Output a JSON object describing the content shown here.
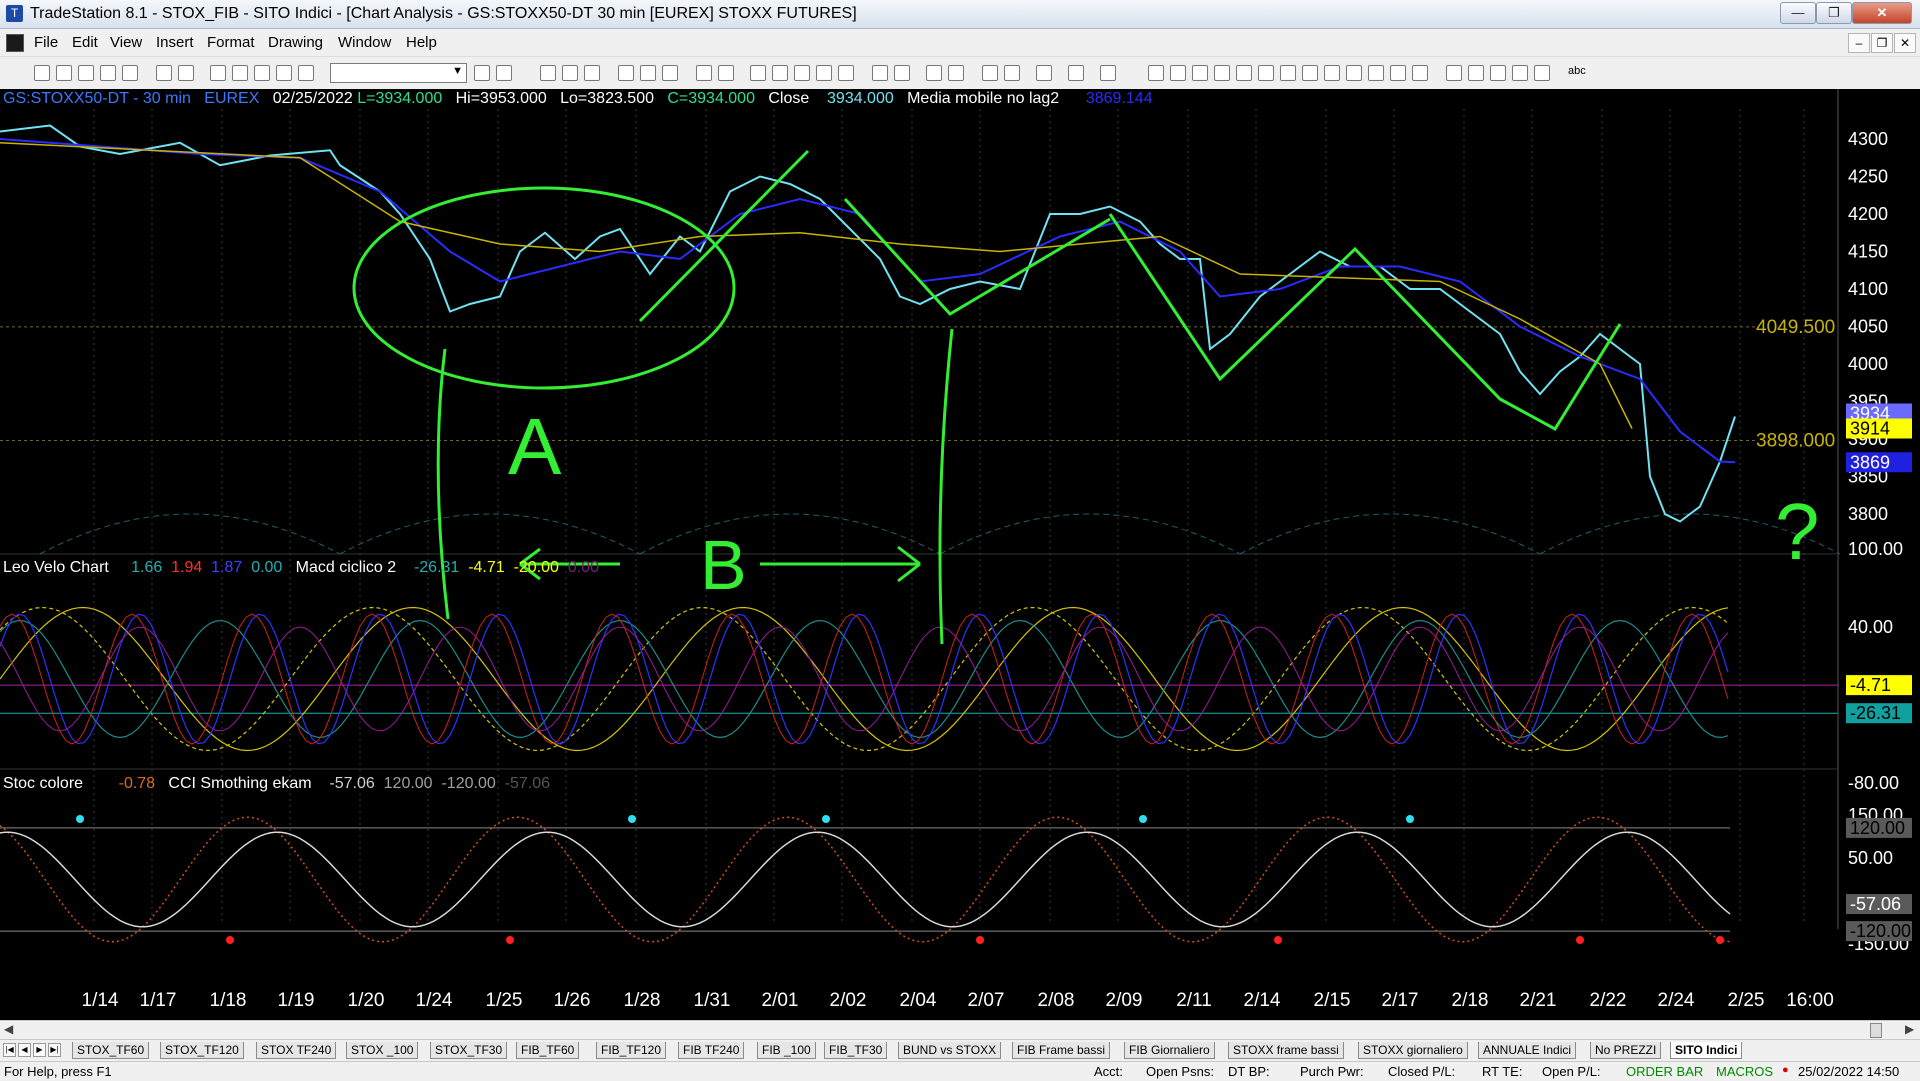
{
  "window": {
    "title": "TradeStation 8.1 - STOX_FIB - SITO Indici - [Chart Analysis - GS:STOXX50-DT  30 min  [EUREX] STOXX FUTURES]",
    "minimize": "—",
    "maximize": "❐",
    "close": "✕"
  },
  "menu": [
    "File",
    "Edit",
    "View",
    "Insert",
    "Format",
    "Drawing",
    "Window",
    "Help"
  ],
  "mdi": {
    "minimize": "–",
    "restore": "❐",
    "close": "✕"
  },
  "toolbar": {
    "abc_label": "abc"
  },
  "chart": {
    "header": {
      "symbol": "GS:STOXX50-DT - 30 min",
      "exchange": "EUREX",
      "date": "02/25/2022",
      "last": "L=3934.000",
      "high": "Hi=3953.000",
      "low": "Lo=3823.500",
      "close": "C=3934.000",
      "close_label": "Close",
      "close_value": "3934.000",
      "ma_label": "Media mobile no lag2",
      "ma_value": "3869.144"
    },
    "price_axis": [
      "4300",
      "4250",
      "4200",
      "4150",
      "4100",
      "4050",
      "4000",
      "3950",
      "3900",
      "3850",
      "3800"
    ],
    "price_marks": {
      "level_high": "4049.500",
      "level_low": "3898.000",
      "tag_close": "3934",
      "tag_yellow": "3914",
      "tag_ma": "3869"
    },
    "panel2": {
      "name": "Leo Velo Chart",
      "v1": "1.66",
      "v2": "1.94",
      "v3": "1.87",
      "v4": "0.00",
      "name2": "Macd ciclico 2",
      "m1": "-26.31",
      "m2": "-4.71",
      "m3": "-20.00",
      "m4": "0.00",
      "axis": [
        "100.00",
        "40.00",
        "-80.00"
      ],
      "tag_a": "-4.71",
      "tag_b": "-26.31"
    },
    "panel3": {
      "name": "Stoc colore",
      "v1": "-0.78",
      "name2": "CCI Smothing ekam",
      "c1": "-57.06",
      "c2": "120.00",
      "c3": "-120.00",
      "c4": "-57.06",
      "axis": [
        "150.00",
        "50.00",
        "-150.00"
      ],
      "tag_a": "120.00",
      "tag_b": "-57.06",
      "tag_c": "-120.00"
    },
    "date_axis": [
      "1/14",
      "1/17",
      "1/18",
      "1/19",
      "1/20",
      "1/24",
      "1/25",
      "1/26",
      "1/28",
      "1/31",
      "2/01",
      "2/02",
      "2/04",
      "2/07",
      "2/08",
      "2/09",
      "2/11",
      "2/14",
      "2/15",
      "2/17",
      "2/18",
      "2/21",
      "2/22",
      "2/24",
      "2/25",
      "16:00"
    ]
  },
  "tabs": [
    "STOX_TF60",
    "STOX_TF120",
    "STOX TF240",
    "STOX _100",
    "STOX_TF30",
    "FIB_TF60",
    "FIB_TF120",
    "FIB TF240",
    "FIB _100",
    "FIB_TF30",
    "BUND vs STOXX",
    "FIB Frame bassi",
    "FIB Giornaliero",
    "STOXX frame bassi",
    "STOXX giornaliero",
    "ANNUALE Indici",
    "No PREZZI",
    "SITO Indici"
  ],
  "status": {
    "help": "For Help, press F1",
    "acct": "Acct:",
    "open_psns": "Open Psns:",
    "dt_bp": "DT BP:",
    "purch_pwr": "Purch Pwr:",
    "closed_pl": "Closed P/L:",
    "rt_te": "RT TE:",
    "open_pl": "Open P/L:",
    "order_bar": "ORDER BAR",
    "macros": "MACROS",
    "datetime": "25/02/2022 14:50"
  },
  "colors": {
    "price_line": "#6fe3f2",
    "ma_blue": "#2b2bff",
    "ma_yellow": "#c8b400",
    "annotation": "#33ee33",
    "axis_text": "#ffffff",
    "background": "#000000"
  },
  "annotations": {
    "label_a": "A",
    "label_b": "B",
    "label_q": "?"
  }
}
